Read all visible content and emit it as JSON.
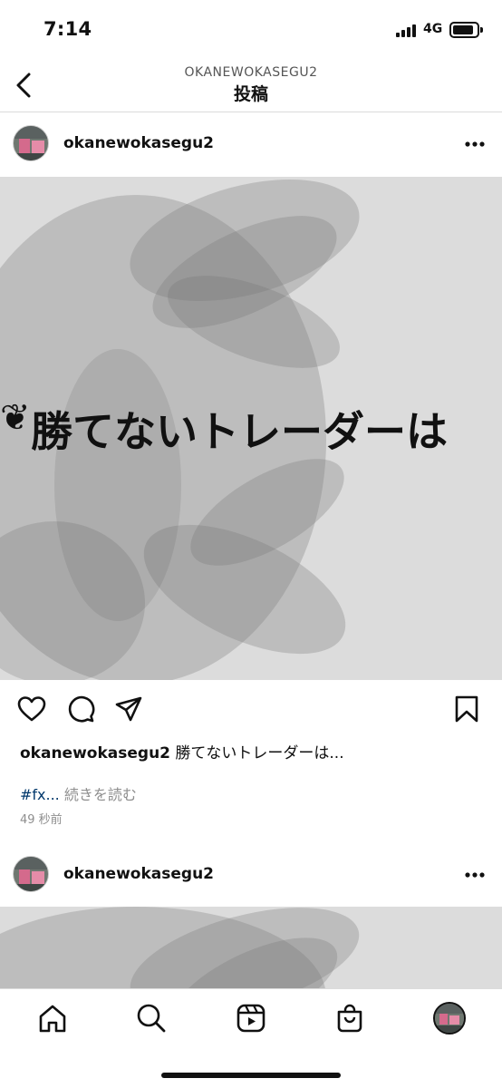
{
  "status_bar": {
    "time": "7:14",
    "network": "4G"
  },
  "header": {
    "username": "OKANEWOKASEGU2",
    "title": "投稿"
  },
  "posts": [
    {
      "username": "okanewokasegu2",
      "image_text": "勝てないトレーダーは",
      "caption_user": "okanewokasegu2",
      "caption_text": "勝てないトレーダーは...",
      "hashtag": "#fx...",
      "more_label": "続きを読む",
      "timestamp": "49 秒前"
    },
    {
      "username": "okanewokasegu2"
    }
  ],
  "icons": {
    "back": "chevron-left-icon",
    "more": "ellipsis-icon",
    "like": "heart-icon",
    "comment": "comment-icon",
    "share": "send-icon",
    "save": "bookmark-icon",
    "tabs": [
      "home-icon",
      "search-icon",
      "reels-icon",
      "shop-icon",
      "profile-avatar"
    ]
  },
  "colors": {
    "hashtag": "#00376b",
    "muted": "#8e8e8e",
    "divider": "#dbdbdb"
  }
}
